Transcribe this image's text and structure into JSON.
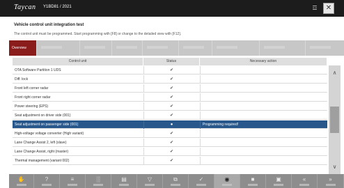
{
  "window": {
    "brand": "Taycan",
    "vin": "Y1BD81 / 2021",
    "network_icon": "connection-icon",
    "close_label": "✕"
  },
  "heading": "Vehicle control unit integration test",
  "subtext": "The control unit must be programmed. Start programming with [F8] or change to the detailed view with [F12].",
  "tabs": [
    "Overview",
    "",
    "",
    "",
    "",
    "",
    "",
    "",
    ""
  ],
  "table": {
    "headers": [
      "Control unit",
      "Status",
      "Necessary action"
    ],
    "rows": [
      {
        "name": "OTA Software Partition 1 UDS",
        "status": "✔",
        "action": ""
      },
      {
        "name": "Diff. lock",
        "status": "✔",
        "action": ""
      },
      {
        "name": "Front left corner radar",
        "status": "✔",
        "action": ""
      },
      {
        "name": "Front right corner radar",
        "status": "✔",
        "action": ""
      },
      {
        "name": "Power steering (EPS)",
        "status": "✔",
        "action": ""
      },
      {
        "name": "Seat adjustment on driver side (001)",
        "status": "✔",
        "action": ""
      },
      {
        "name": "Seat adjustment on passenger side (001)",
        "status": "●",
        "action": "Programming required!"
      },
      {
        "name": "High-voltage voltage converter (High variant)",
        "status": "✔",
        "action": ""
      },
      {
        "name": "Lane Change Assist 2, left (slave)",
        "status": "✔",
        "action": ""
      },
      {
        "name": "Lane Change Assist, right (master)",
        "status": "✔",
        "action": ""
      },
      {
        "name": "Thermal management (variant 002)",
        "status": "✔",
        "action": ""
      }
    ],
    "selected_index": 6
  },
  "scrollbar": {
    "up": "∧",
    "down": "∨"
  },
  "toolbar": {
    "buttons": [
      {
        "icon": "hand-icon",
        "glyph": "✋"
      },
      {
        "icon": "help-icon",
        "glyph": "?"
      },
      {
        "icon": "list-icon",
        "glyph": "≡"
      },
      {
        "icon": "signal-icon",
        "glyph": "░"
      },
      {
        "icon": "document-icon",
        "glyph": "▤"
      },
      {
        "icon": "filter-icon",
        "glyph": "▽"
      },
      {
        "icon": "copy-icon",
        "glyph": "⧉"
      },
      {
        "icon": "check-icon",
        "glyph": "✓"
      },
      {
        "icon": "target-icon",
        "glyph": "◉"
      },
      {
        "icon": "chat-icon",
        "glyph": "■"
      },
      {
        "icon": "print-icon",
        "glyph": "▣"
      },
      {
        "icon": "back-icon",
        "glyph": "«"
      },
      {
        "icon": "forward-icon",
        "glyph": "»"
      }
    ]
  }
}
